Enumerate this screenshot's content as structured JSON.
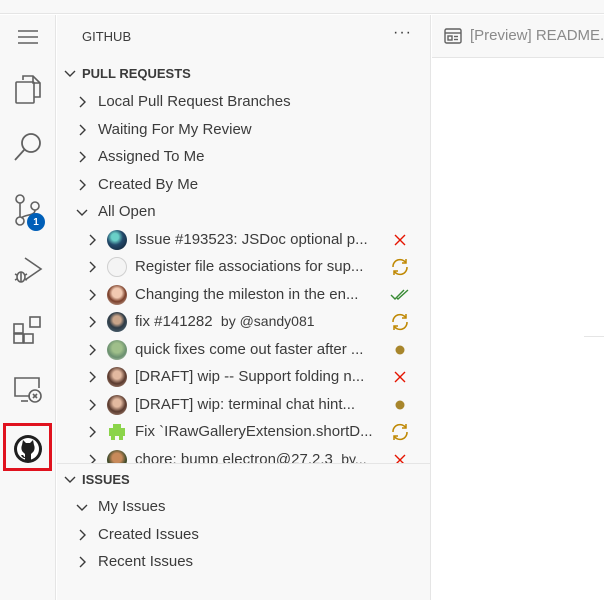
{
  "sidebar": {
    "title": "GITHUB",
    "more": "···",
    "pull_requests": {
      "header": "PULL REQUESTS",
      "categories": [
        {
          "label": "Local Pull Request Branches"
        },
        {
          "label": "Waiting For My Review"
        },
        {
          "label": "Assigned To Me"
        },
        {
          "label": "Created By Me"
        },
        {
          "label": "All Open"
        }
      ],
      "items": [
        {
          "title": "Issue #193523: JSDoc optional p...",
          "author": "",
          "status": "closed",
          "status_icon": "x-icon"
        },
        {
          "title": "Register file associations for sup...",
          "author": "",
          "status": "pending",
          "status_icon": "sync-icon"
        },
        {
          "title": "Changing the mileston in the en...",
          "author": "",
          "status": "passed",
          "status_icon": "double-check-icon"
        },
        {
          "title": "fix #141282",
          "author": "by @sandy081",
          "status": "pending",
          "status_icon": "sync-icon"
        },
        {
          "title": "quick fixes come out faster after ...",
          "author": "",
          "status": "draft",
          "status_icon": "dot-icon"
        },
        {
          "title": "[DRAFT] wip -- Support folding n...",
          "author": "",
          "status": "closed",
          "status_icon": "x-icon"
        },
        {
          "title": "[DRAFT] wip: terminal chat hint...",
          "author": "",
          "status": "draft",
          "status_icon": "dot-icon"
        },
        {
          "title": "Fix `IRawGalleryExtension.shortD...",
          "author": "",
          "status": "pending",
          "status_icon": "sync-icon"
        },
        {
          "title": "chore: bump electron@27.2.3",
          "author": "by...",
          "status": "closed",
          "status_icon": "x-icon"
        }
      ]
    },
    "issues": {
      "header": "ISSUES",
      "categories": [
        {
          "label": "My Issues"
        },
        {
          "label": "Created Issues"
        },
        {
          "label": "Recent Issues"
        }
      ]
    }
  },
  "activity_bar": {
    "items": [
      "menu-icon",
      "explorer-icon",
      "search-icon",
      "source-control-icon",
      "run-debug-icon",
      "extensions-icon",
      "remote-explorer-icon",
      "github-icon"
    ],
    "source_control_badge": "1"
  },
  "editor": {
    "tab_label": "[Preview] README.md"
  },
  "colors": {
    "accent": "#005fb8",
    "closed": "#e51400",
    "pending": "#bf8803",
    "passed": "#388a34",
    "highlight": "#e0121e"
  }
}
